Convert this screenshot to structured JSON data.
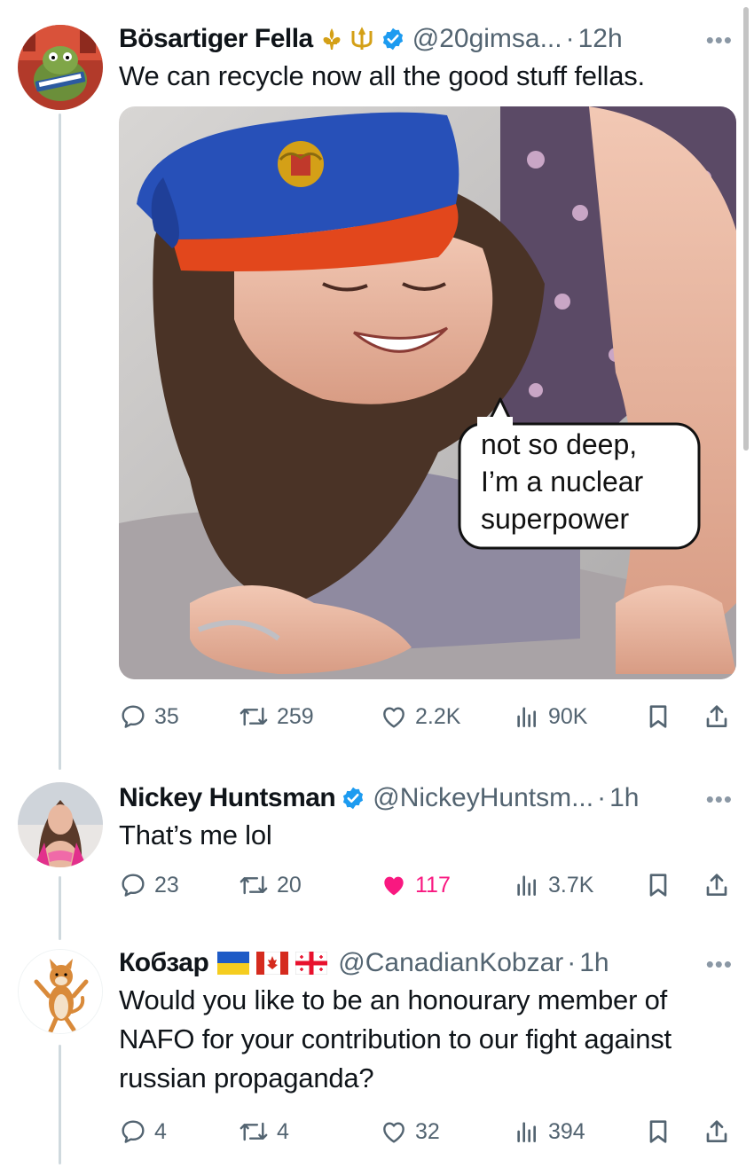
{
  "tweets": [
    {
      "name": "Bösartiger Fella",
      "name_emoji": "⚜️🔱",
      "handle": "@20gimsa...",
      "time": "12h",
      "text": "We can recycle now all the good stuff fellas.",
      "media": {
        "speech_bubble": [
          "not so deep,",
          "I’m a nuclear",
          "superpower"
        ]
      },
      "stats": {
        "replies": "35",
        "reposts": "259",
        "likes": "2.2K",
        "views": "90K"
      },
      "liked": false
    },
    {
      "name": "Nickey Huntsman",
      "handle": "@NickeyHuntsm...",
      "time": "1h",
      "text": "That’s me lol",
      "stats": {
        "replies": "23",
        "reposts": "20",
        "likes": "117",
        "views": "3.7K"
      },
      "liked": true
    },
    {
      "name": "Кобзар",
      "handle": "@CanadianKobzar",
      "time": "1h",
      "text": "Would you like to be an honourary member of NAFO for your contribution to our fight against russian propaganda?",
      "stats": {
        "replies": "4",
        "reposts": "4",
        "likes": "32",
        "views": "394"
      },
      "liked": false
    }
  ],
  "colors": {
    "verified": "#1d9bf0",
    "like_active": "#f91880",
    "muted_text": "#536471",
    "thread_line": "#cfd9de"
  },
  "icons": [
    "reply-icon",
    "repost-icon",
    "like-icon",
    "views-icon",
    "bookmark-icon",
    "share-icon",
    "more-icon",
    "verified-badge-icon"
  ]
}
